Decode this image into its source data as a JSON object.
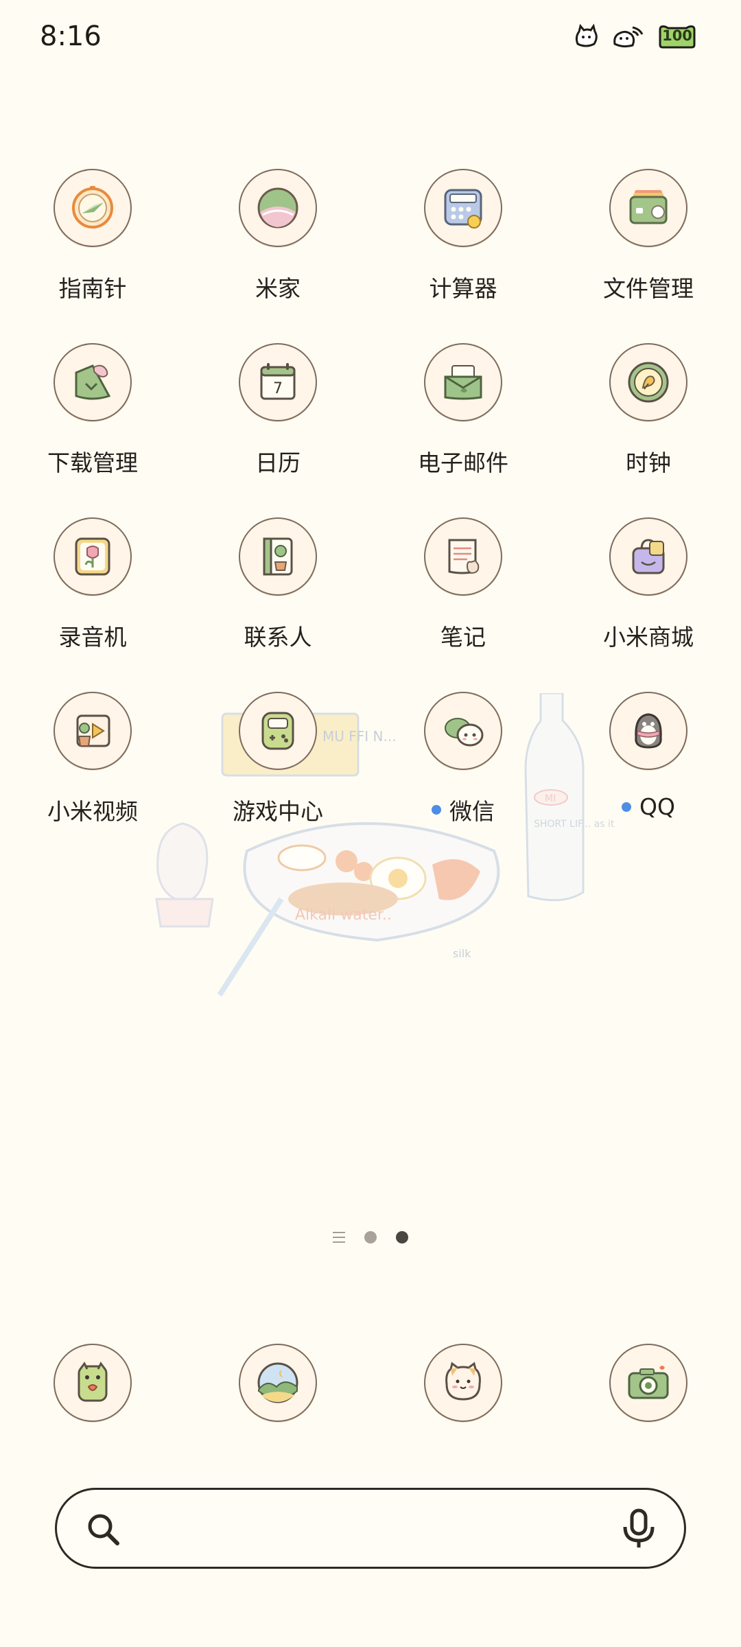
{
  "status_bar": {
    "time": "8:16",
    "battery": "100"
  },
  "apps": [
    [
      {
        "label": "指南针",
        "dot": false
      },
      {
        "label": "米家",
        "dot": false
      },
      {
        "label": "计算器",
        "dot": false
      },
      {
        "label": "文件管理",
        "dot": false
      }
    ],
    [
      {
        "label": "下载管理",
        "dot": false
      },
      {
        "label": "日历",
        "dot": false
      },
      {
        "label": "电子邮件",
        "dot": false
      },
      {
        "label": "时钟",
        "dot": false
      }
    ],
    [
      {
        "label": "录音机",
        "dot": false
      },
      {
        "label": "联系人",
        "dot": false
      },
      {
        "label": "笔记",
        "dot": false
      },
      {
        "label": "小米商城",
        "dot": false
      }
    ],
    [
      {
        "label": "小米视频",
        "dot": false
      },
      {
        "label": "游戏中心",
        "dot": false
      },
      {
        "label": "微信",
        "dot": true
      },
      {
        "label": "QQ",
        "dot": true
      }
    ]
  ],
  "calendar_day": "7",
  "wallpaper_text": {
    "muffin": "MU FFI N...",
    "bottle": "SHORT LIF... as it i ike a...",
    "bottle_badge": "MI",
    "plate": "Alkali water..",
    "sign": "silk"
  },
  "page_indicator": {
    "pages": 2,
    "active": 2
  },
  "dock": [
    {
      "icon": "phone-frog-icon"
    },
    {
      "icon": "gallery-landscape-icon"
    },
    {
      "icon": "messages-cat-icon"
    },
    {
      "icon": "camera-icon"
    }
  ],
  "colors": {
    "background": "#fffdf3",
    "icon_border": "#7e6b5c",
    "notification_dot": "#4e8de6",
    "battery": "#9ed36a"
  }
}
